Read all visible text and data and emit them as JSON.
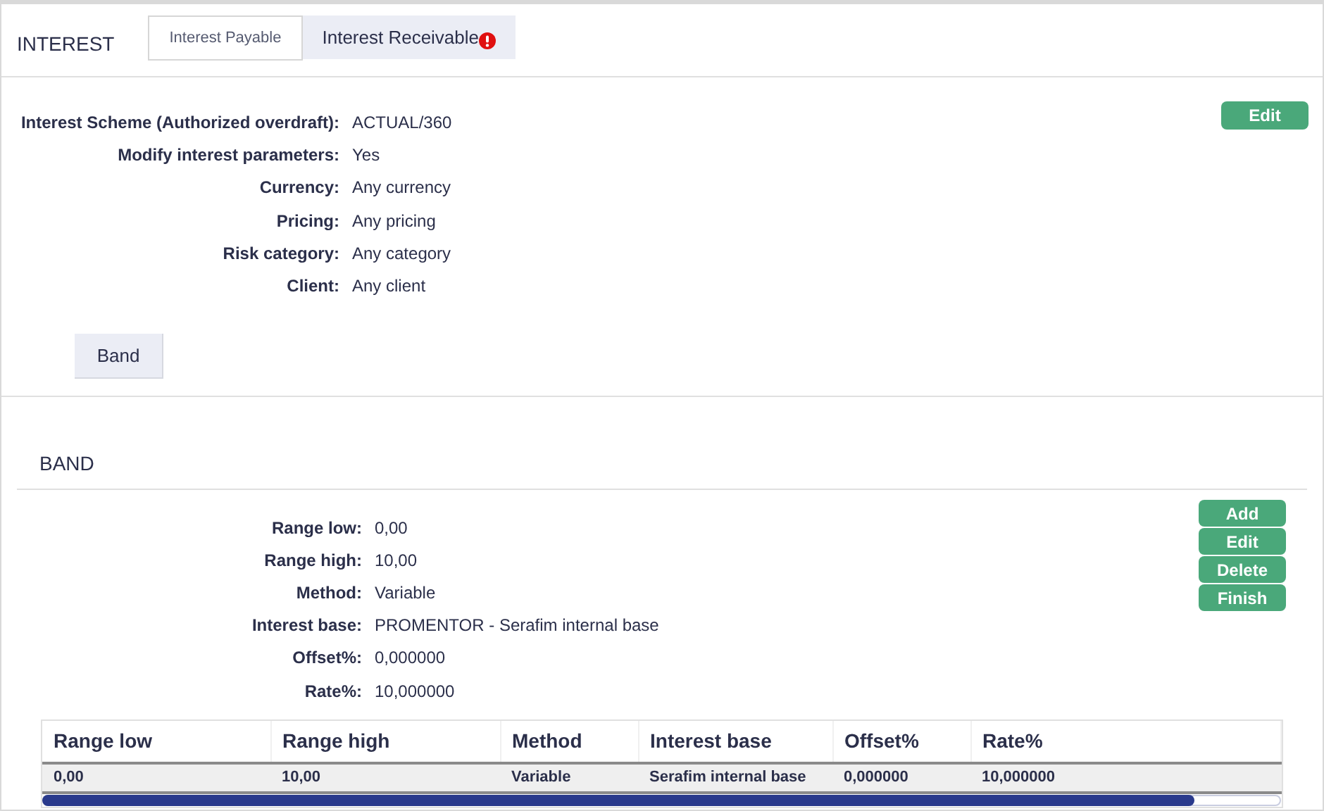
{
  "header": {
    "title": "INTEREST"
  },
  "tabs": [
    {
      "label": "Interest Payable",
      "selected": true,
      "warning": false
    },
    {
      "label": "Interest Receivable",
      "selected": false,
      "warning": true
    }
  ],
  "details": {
    "fields": [
      {
        "label": "Interest Scheme (Authorized overdraft):",
        "value": "ACTUAL/360"
      },
      {
        "label": "Modify interest parameters:",
        "value": "Yes"
      },
      {
        "label": "Currency:",
        "value": "Any currency"
      },
      {
        "label": "Pricing:",
        "value": "Any pricing"
      },
      {
        "label": "Risk category:",
        "value": "Any category"
      },
      {
        "label": "Client:",
        "value": "Any client"
      }
    ],
    "edit_button": "Edit",
    "band_button": "Band"
  },
  "band": {
    "title": "BAND",
    "fields": [
      {
        "label": "Range low:",
        "value": "0,00"
      },
      {
        "label": "Range high:",
        "value": "10,00"
      },
      {
        "label": "Method:",
        "value": "Variable"
      },
      {
        "label": "Interest base:",
        "value": "PROMENTOR - Serafim internal base"
      },
      {
        "label": "Offset%:",
        "value": "0,000000"
      },
      {
        "label": "Rate%:",
        "value": "10,000000"
      }
    ],
    "buttons": [
      "Add",
      "Edit",
      "Delete",
      "Finish"
    ],
    "table": {
      "columns": [
        "Range low",
        "Range high",
        "Method",
        "Interest base",
        "Offset%",
        "Rate%"
      ],
      "rows": [
        {
          "cells": [
            "0,00",
            "10,00",
            "Variable",
            "Serafim internal base",
            "0,000000",
            "10,000000"
          ],
          "selected": true
        }
      ]
    }
  }
}
